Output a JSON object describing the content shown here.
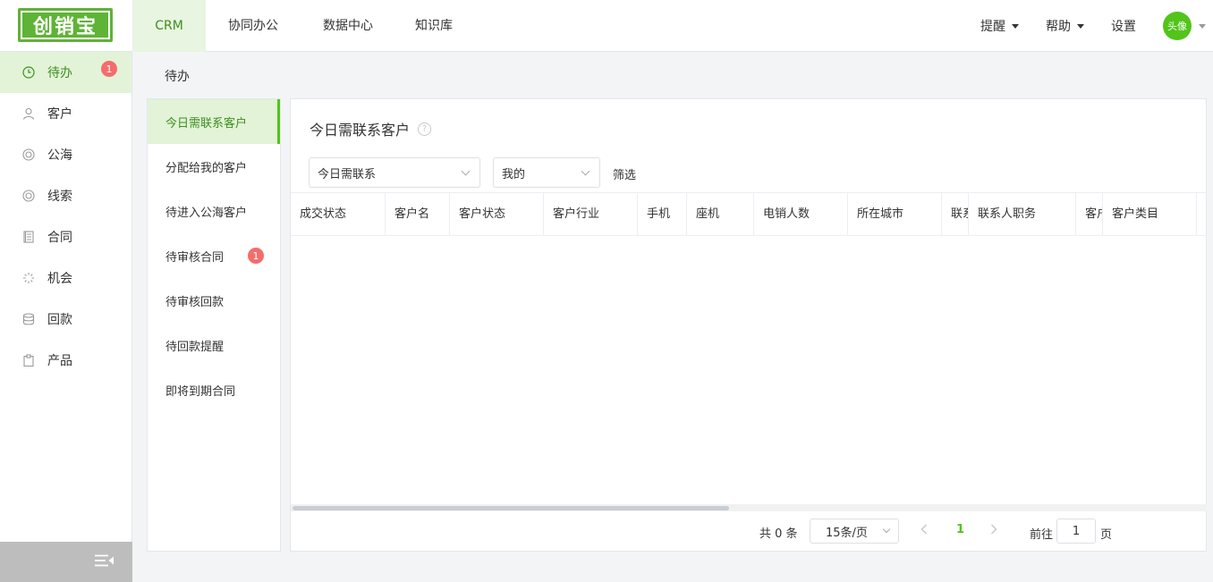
{
  "app": {
    "logo_text": "创销宝",
    "accent_color": "#52c41a"
  },
  "topnav": {
    "items": [
      {
        "label": "CRM"
      },
      {
        "label": "协同办公"
      },
      {
        "label": "数据中心"
      },
      {
        "label": "知识库"
      }
    ],
    "active": "CRM",
    "right": {
      "reminder_label": "提醒",
      "help_label": "帮助",
      "settings_label": "设置",
      "avatar_text": "头像"
    }
  },
  "sidebar": {
    "items": [
      {
        "label": "待办",
        "icon": "clock-icon",
        "badge": "1"
      },
      {
        "label": "客户",
        "icon": "user-icon"
      },
      {
        "label": "公海",
        "icon": "lifebuoy-icon"
      },
      {
        "label": "线索",
        "icon": "lifebuoy-icon"
      },
      {
        "label": "合同",
        "icon": "document-icon"
      },
      {
        "label": "机会",
        "icon": "loading-icon"
      },
      {
        "label": "回款",
        "icon": "database-icon"
      },
      {
        "label": "产品",
        "icon": "clipboard-icon"
      }
    ],
    "active": "待办",
    "toggle_icon": "menu-collapse-icon"
  },
  "breadcrumb": {
    "current": "待办"
  },
  "submenu": {
    "items": [
      {
        "label": "今日需联系客户"
      },
      {
        "label": "分配给我的客户"
      },
      {
        "label": "待进入公海客户"
      },
      {
        "label": "待审核合同",
        "badge": "1"
      },
      {
        "label": "待审核回款"
      },
      {
        "label": "待回款提醒"
      },
      {
        "label": "即将到期合同"
      }
    ],
    "active": "今日需联系客户"
  },
  "main": {
    "title": "今日需联系客户",
    "help_icon": "question-circle-icon",
    "filters": {
      "scope_select_value": "今日需联系",
      "owner_select_value": "我的",
      "filter_label": "筛选"
    },
    "table": {
      "columns": [
        {
          "label": "成交状态"
        },
        {
          "label": "客户名"
        },
        {
          "label": "客户状态"
        },
        {
          "label": "客户行业"
        },
        {
          "label": "手机"
        },
        {
          "label": "座机"
        },
        {
          "label": "电销人数"
        },
        {
          "label": "所在城市"
        },
        {
          "label": "联系"
        },
        {
          "label": "联系人职务"
        },
        {
          "label": "客户"
        },
        {
          "label": "客户类目"
        }
      ],
      "rows": []
    },
    "pagination": {
      "total_text": "共 0 条",
      "page_size": "15条/页",
      "current_page": "1",
      "goto_label": "前往",
      "goto_value": "1",
      "page_suffix": "页"
    }
  }
}
